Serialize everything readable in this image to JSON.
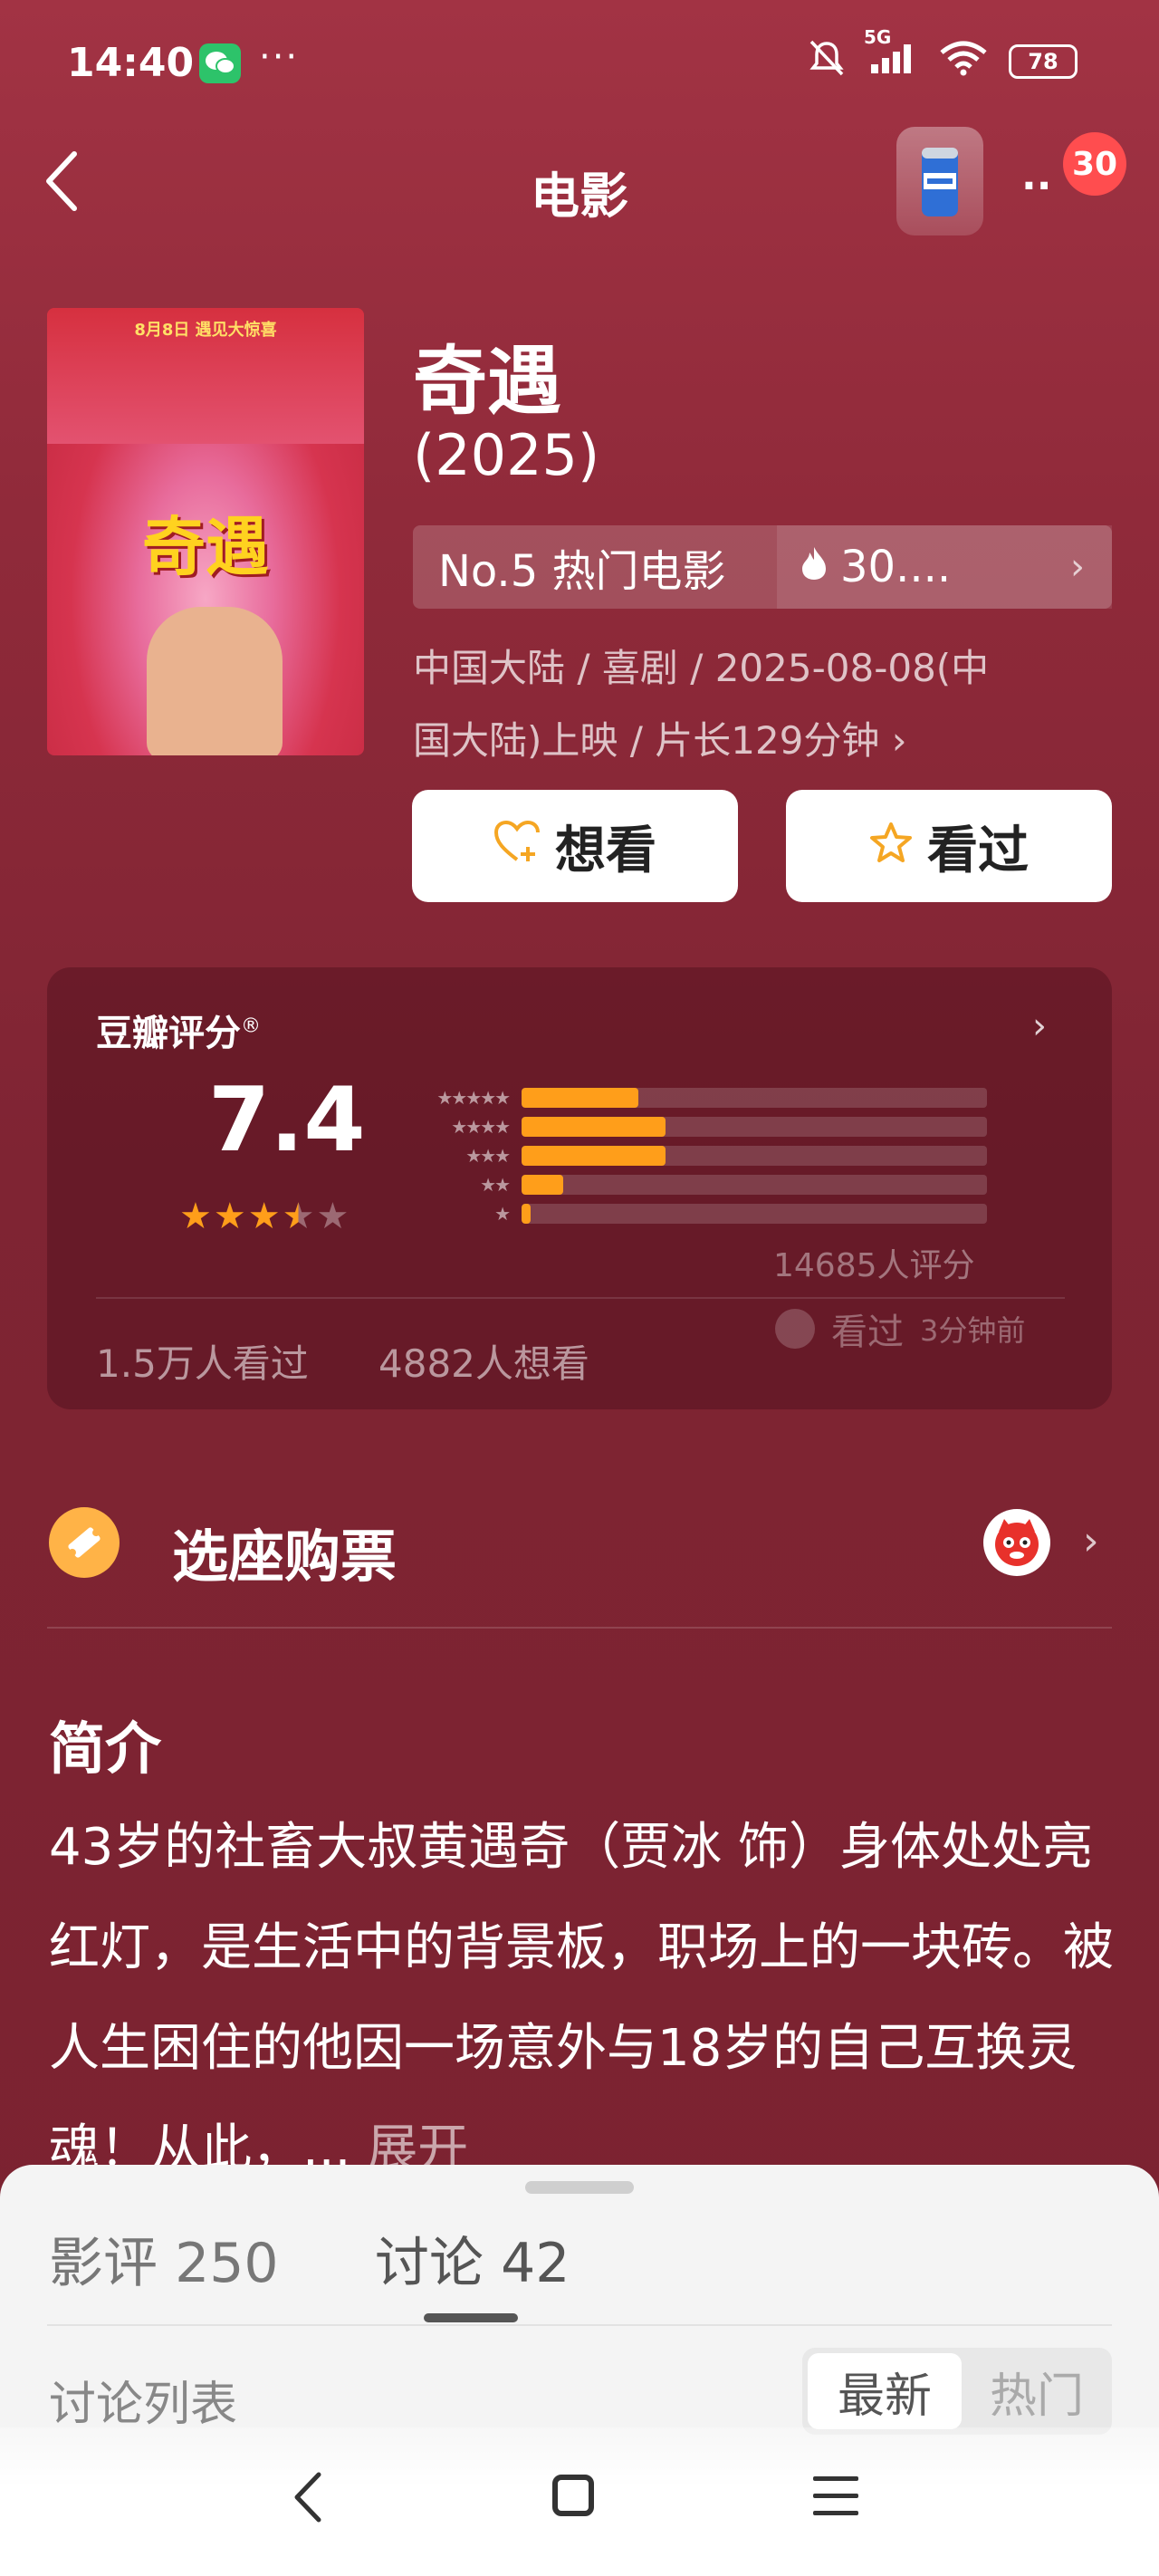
{
  "status_bar": {
    "time": "14:40",
    "more": "···",
    "network": "5G",
    "battery": "78",
    "icons": [
      "wechat-icon",
      "mute-icon",
      "signal-icon",
      "wifi-icon",
      "battery-icon"
    ]
  },
  "nav": {
    "title": "电影",
    "more": "··",
    "badge": "30",
    "icons": [
      "back-icon",
      "beer-can-icon",
      "more-icon"
    ]
  },
  "movie": {
    "title": "奇遇",
    "year": "(2025)",
    "poster": {
      "top_line": "8月8日 遇见大惊喜",
      "title": "奇遇"
    },
    "rank": "No.5 热门电影",
    "heat": "30....",
    "meta_line1": "中国大陆 / 喜剧 / 2025-08-08(中",
    "meta_line2": "国大陆)上映 / 片长129分钟 ›"
  },
  "actions": {
    "want_label": "想看",
    "seen_label": "看过"
  },
  "rating": {
    "title": "豆瓣评分",
    "registered": "®",
    "score": "7.4",
    "stars_display": 3.5,
    "distribution": [
      {
        "stars": "★★★★★",
        "pct": 25
      },
      {
        "stars": "★★★★",
        "pct": 31
      },
      {
        "stars": "★★★",
        "pct": 31
      },
      {
        "stars": "★★",
        "pct": 9
      },
      {
        "stars": "★",
        "pct": 2
      }
    ],
    "count": "14685人评分",
    "seen_count": "1.5万人看过",
    "want_count": "4882人想看",
    "recent_action": "看过",
    "recent_time": "3分钟前"
  },
  "ticket": {
    "label": "选座购票",
    "icons": [
      "ticket-icon",
      "maoyan-cat-icon",
      "chevron-right-icon"
    ]
  },
  "synopsis": {
    "title": "简介",
    "text": "43岁的社畜大叔黄遇奇（贾冰 饰）身体处处亮红灯，是生活中的背景板，职场上的一块砖。被人生困住的他因一场意外与18岁的自己互换灵魂！从此，...",
    "expand": " 展开"
  },
  "sheet": {
    "tab_reviews": "影评 250",
    "tab_discuss": "讨论 42",
    "list_label": "讨论列表",
    "sort_new": "最新",
    "sort_hot": "热门"
  },
  "colors": {
    "background": "#8f2a39",
    "star": "#ff9e1a",
    "badge": "#ff4d4f",
    "ticket_icon": "#ffb347"
  }
}
